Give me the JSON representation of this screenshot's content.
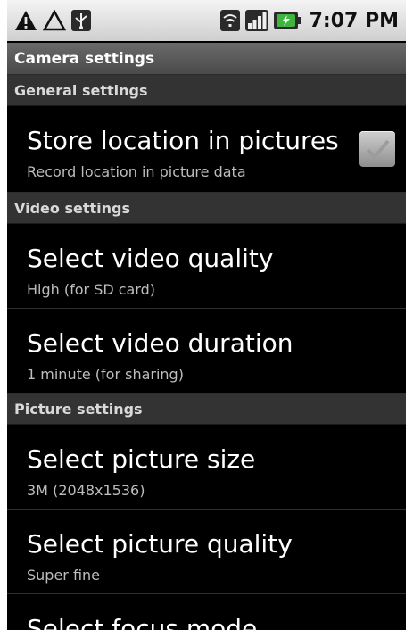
{
  "status_bar": {
    "time": "7:07 PM",
    "icons": [
      "warning-icon",
      "warning-outline-icon",
      "usb-icon",
      "wifi-icon",
      "signal-icon",
      "battery-charging-icon"
    ]
  },
  "title_bar": {
    "title": "Camera settings"
  },
  "categories": {
    "general": "General settings",
    "video": "Video settings",
    "picture": "Picture settings"
  },
  "prefs": {
    "store_location": {
      "title": "Store location in pictures",
      "summary": "Record location in picture data",
      "checked": true
    },
    "video_quality": {
      "title": "Select video quality",
      "summary": "High (for SD card)"
    },
    "video_duration": {
      "title": "Select video duration",
      "summary": "1 minute (for sharing)"
    },
    "picture_size": {
      "title": "Select picture size",
      "summary": "3M (2048x1536)"
    },
    "picture_quality": {
      "title": "Select picture quality",
      "summary": "Super fine"
    },
    "focus_mode": {
      "title": "Select focus mode"
    }
  },
  "colors": {
    "background": "#000000",
    "category_bg": "#333333",
    "title_bar_bg": "#5a5a5a",
    "status_bar_bg": "#e0e0e0",
    "battery_accent": "#3fb53f"
  }
}
